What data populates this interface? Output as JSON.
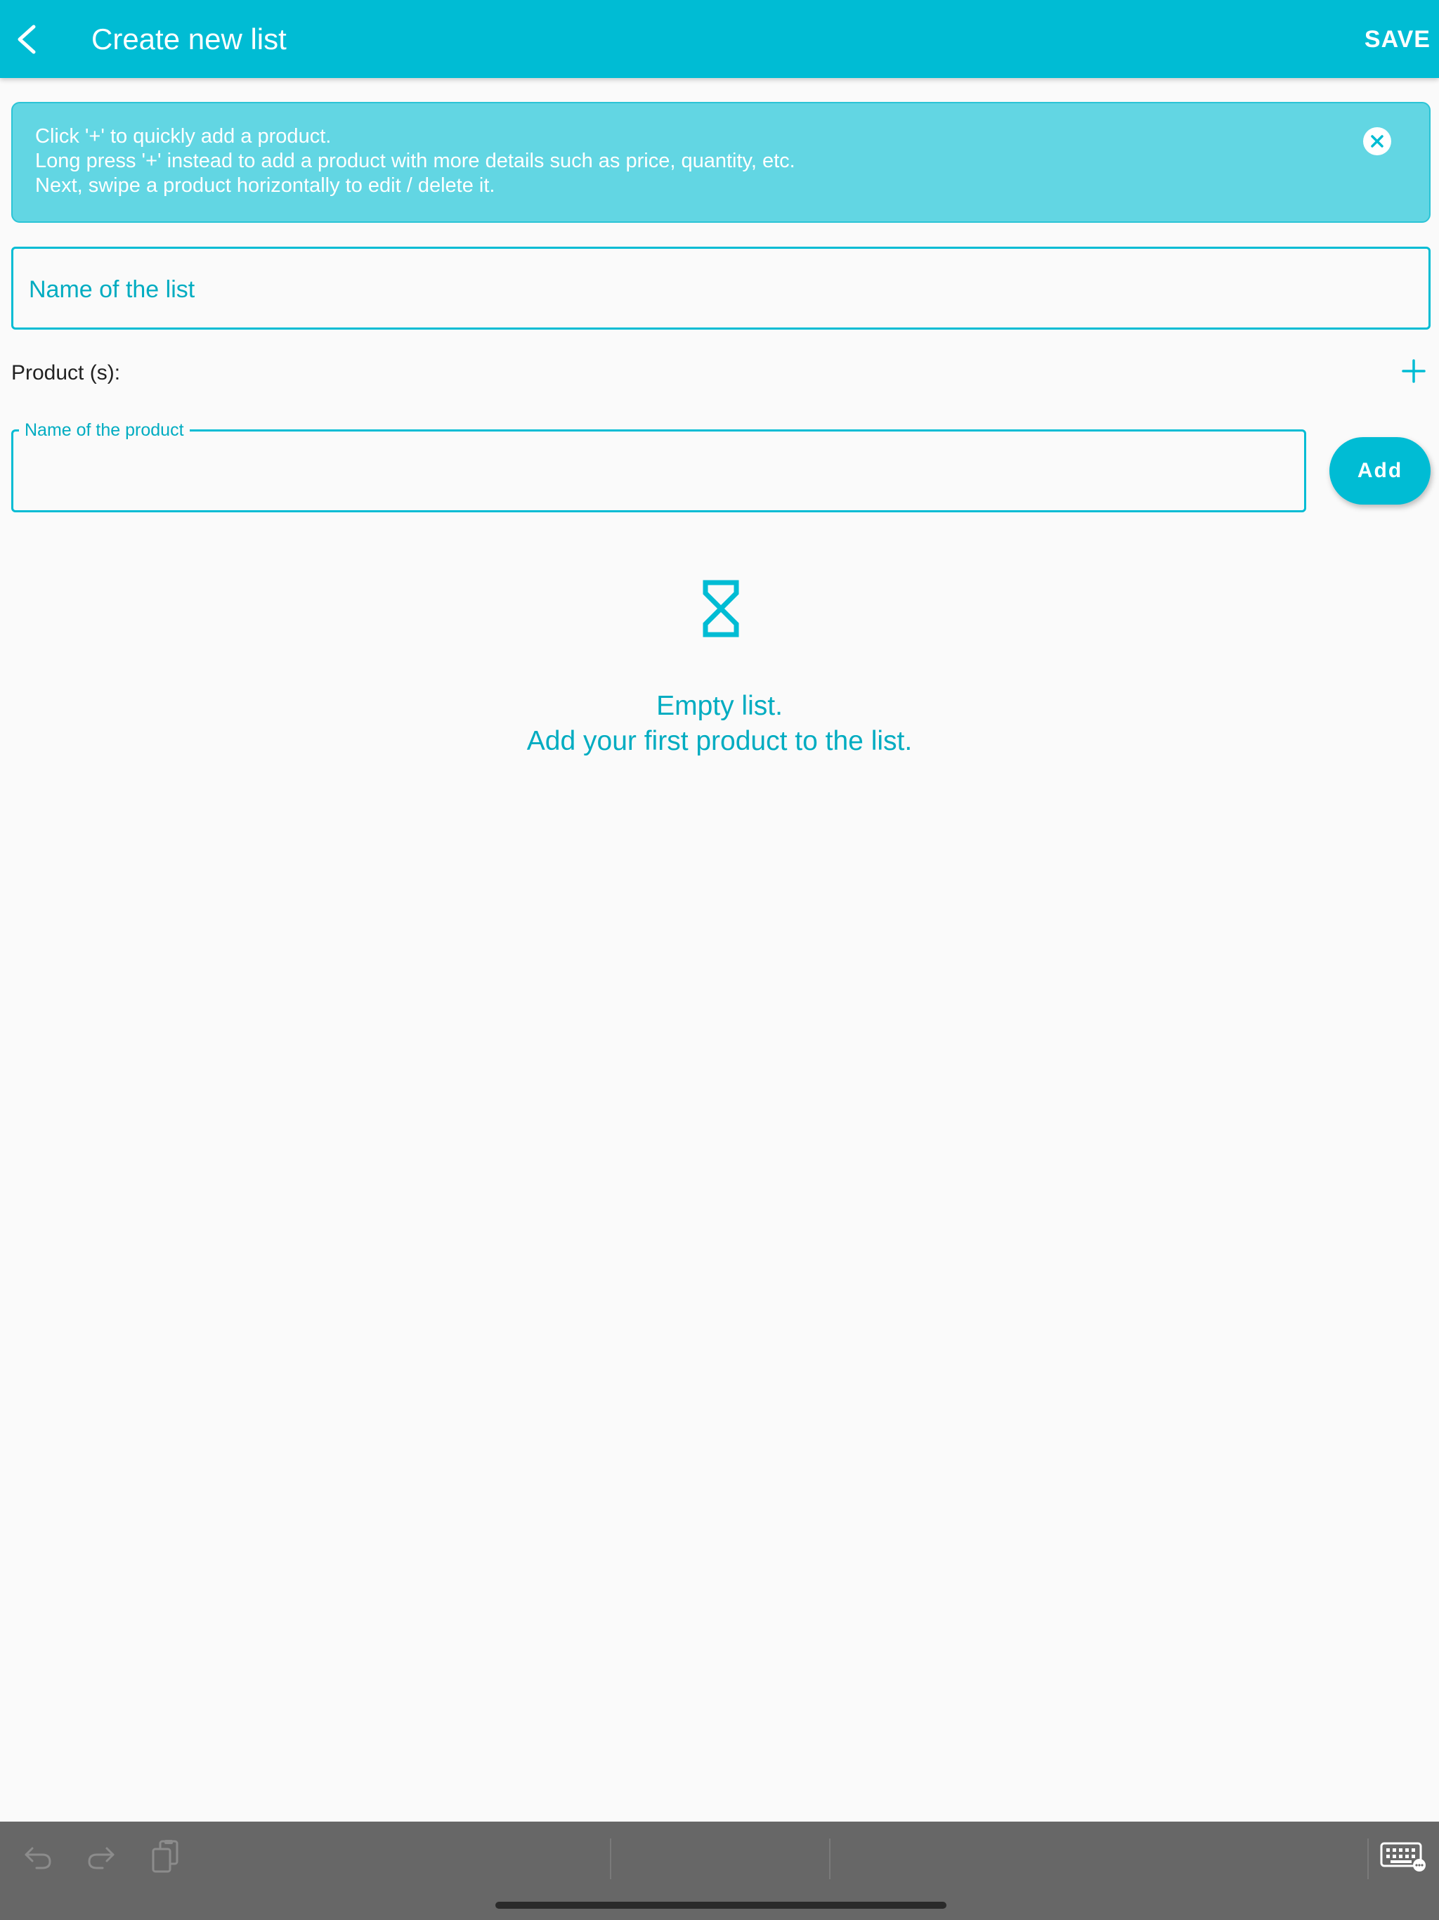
{
  "colors": {
    "accent": "#00bcd4",
    "accent_text": "#00acc1",
    "banner_bg": "#62d6e3",
    "background": "#fafafa",
    "keyboard_bar": "#676767"
  },
  "appbar": {
    "back_icon": "chevron-left-icon",
    "title": "Create new list",
    "save_label": "SAVE"
  },
  "info_banner": {
    "lines": [
      "Click '+' to quickly add a product.",
      "Long press '+' instead to add a product with more details such as price, quantity, etc.",
      "Next, swipe a product horizontally to edit / delete it."
    ],
    "close_icon": "close-circle-icon"
  },
  "list_name": {
    "placeholder": "Name of the list",
    "value": ""
  },
  "products": {
    "label": "Product (s):",
    "add_icon": "plus-icon"
  },
  "product_input": {
    "label": "Name of the product",
    "value": "",
    "add_button_label": "Add"
  },
  "empty_state": {
    "icon": "hourglass-icon",
    "line1": "Empty list.",
    "line2": "Add your first product to the list."
  },
  "keyboard_bar": {
    "buttons": [
      "undo-icon",
      "redo-icon",
      "paste-icon",
      "keyboard-icon"
    ]
  }
}
